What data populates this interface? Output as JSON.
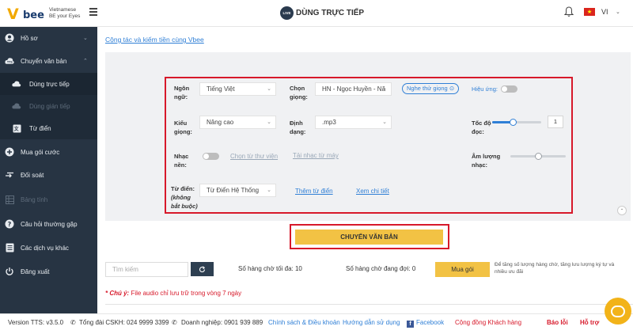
{
  "brand": {
    "name": "bee",
    "tagline_line1": "Vietnamese",
    "tagline_line2": "BE your Eyes"
  },
  "header": {
    "live_badge": "LIVE",
    "title": "DÙNG TRỰC TIẾP",
    "language": "VI"
  },
  "sidebar": {
    "items": [
      {
        "label": "Hồ sơ",
        "icon": "user-circle-icon"
      },
      {
        "label": "Chuyển văn bản",
        "icon": "tts-icon"
      },
      {
        "label": "Dùng trực tiếp",
        "icon": "cloud-icon"
      },
      {
        "label": "Dùng gián tiếp",
        "icon": "cloud-icon"
      },
      {
        "label": "Từ điển",
        "icon": "dictionary-icon"
      },
      {
        "label": "Mua gói cước",
        "icon": "plus-circle-icon"
      },
      {
        "label": "Đối soát",
        "icon": "transfer-icon"
      },
      {
        "label": "Bảng tính",
        "icon": "table-icon"
      },
      {
        "label": "Câu hỏi thường gặp",
        "icon": "question-icon"
      },
      {
        "label": "Các dịch vụ khác",
        "icon": "list-icon"
      },
      {
        "label": "Đăng xuất",
        "icon": "power-icon"
      }
    ]
  },
  "content": {
    "collab_link": "Cộng tác và kiếm tiền cùng Vbee",
    "form": {
      "language_label_1": "Ngôn",
      "language_label_2": "ngữ:",
      "language_value": "Tiếng Việt",
      "voice_label_1": "Chọn",
      "voice_label_2": "giọng:",
      "voice_value": "HN - Ngọc Huyền - Nă",
      "listen_button": "Nghe thử giọng",
      "effect_label": "Hiệu ứng:",
      "type_label_1": "Kiểu",
      "type_label_2": "giọng:",
      "type_value": "Nâng cao",
      "format_label_1": "Định",
      "format_label_2": "dạng:",
      "format_value": ".mp3",
      "speed_label_1": "Tốc độ",
      "speed_label_2": "đọc:",
      "speed_value": "1",
      "speed_fraction": 0.42,
      "music_label_1": "Nhạc",
      "music_label_2": "nền:",
      "choose_library": "Chọn từ thư viện",
      "upload_music": "Tải nhạc từ máy",
      "volume_label_1": "Âm lượng",
      "volume_label_2": "nhạc:",
      "volume_fraction": 0.5,
      "dictionary_label": "Từ điển:",
      "dictionary_optional_1": "(không",
      "dictionary_optional_2": "bắt buộc)",
      "dictionary_value": "Từ Điển Hệ Thống",
      "add_dictionary": "Thêm từ điển",
      "view_detail": "Xem chi tiết"
    },
    "convert_button": "CHUYỂN VĂN BẢN",
    "search_placeholder": "Tìm kiếm",
    "max_queue": "Số hàng chờ tối đa: 10",
    "waiting_queue": "Số hàng chờ đang đợi: 0",
    "buy_button": "Mua gói",
    "buy_note": "Để tăng số lượng hàng chờ, tăng lưu lượng ký tự và nhiều ưu đãi",
    "note_prefix": "* Chú ý:",
    "note_text": " File audio chỉ lưu trữ trong vòng 7 ngày"
  },
  "footer": {
    "version": "Version TTS: v3.5.0",
    "hotline": "Tổng đài CSKH: 024 9999 3399",
    "business": "Doanh nghiệp: 0901 939 889",
    "policy": "Chính sách & Điều khoản",
    "guide": "Hướng dẫn sử dụng",
    "facebook": "Facebook",
    "community": "Cộng đồng Khách hàng",
    "report": "Báo lỗi",
    "support": "Hỗ trợ"
  },
  "colors": {
    "sidebar_bg": "#273443",
    "accent": "#2f7fd6",
    "button_yellow": "#f2c244",
    "highlight_red": "#d7192a"
  }
}
